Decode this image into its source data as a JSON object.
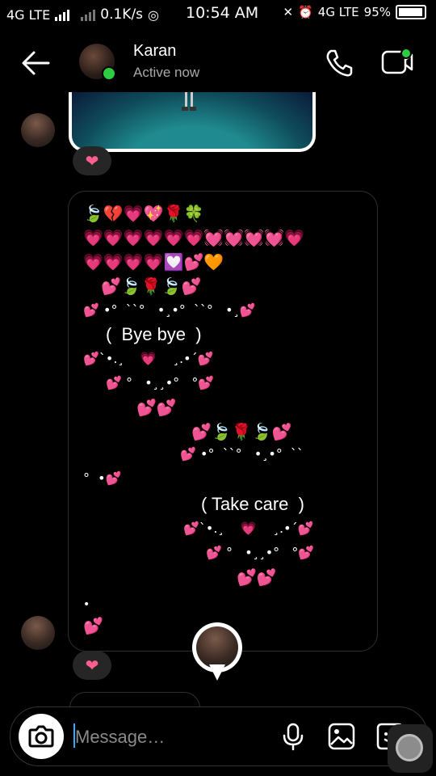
{
  "status_bar": {
    "network_left": "4G LTE",
    "speed": "0.1K/s",
    "time": "10:54 AM",
    "network_right": "4G LTE",
    "battery": "95%"
  },
  "header": {
    "contact_name": "Karan",
    "presence": "Active now"
  },
  "reactions": [
    "❤",
    "❤"
  ],
  "art_message": {
    "row1": "🍃💔💗💖🌹🍀",
    "row2": "💗💗💗💗💗💗💓💓💓💓💗",
    "row3": "💗💗💗💗💟💕🧡",
    "row4": "💕🍃🌹🍃💕",
    "dots1": "💕 •°  ˋˋ°   •¸•°  ˋˋ°   •¸💕",
    "bye": "(  Bye bye  )",
    "dots2": "💕ˋ•.¸    💗    ¸.•ˊ💕",
    "dots3": "💕 °   •¸¸•°   °💕",
    "hearts_mid": "💕💕",
    "row5": "💕🍃🌹🍃💕",
    "dots4": "💕 •°  ˋˋ°   •¸•°  ˋˋ",
    "dots5": "°  •💕",
    "care": "( Take care  )",
    "dots6": "💕ˋ•.¸    💗    ¸.•ˊ💕",
    "dots7": "💕 °   •¸¸•°   °💕",
    "hearts_end": "💕💕",
    "dot_end": "•",
    "heart_end": "💕"
  },
  "composer": {
    "placeholder": "Message…"
  },
  "colors": {
    "online": "#2ecc40",
    "reaction_heart": "#ff5f8f",
    "caret": "#2ab0ff"
  },
  "icons": [
    "back-arrow-icon",
    "phone-icon",
    "video-icon",
    "camera-icon",
    "microphone-icon",
    "gallery-icon",
    "sticker-icon"
  ]
}
